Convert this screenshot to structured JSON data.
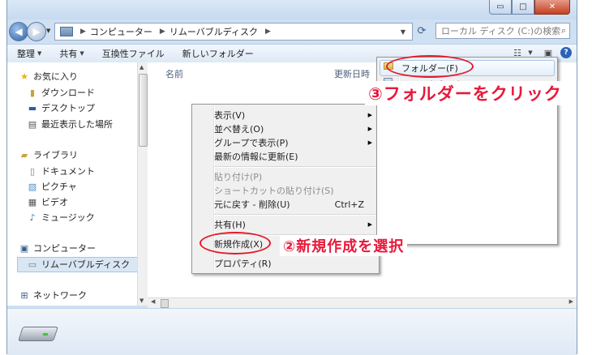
{
  "window": {
    "caption_buttons": {
      "minimize": "▭",
      "maximize": "□",
      "close": "✕"
    }
  },
  "address_bar": {
    "crumbs": [
      "コンピューター",
      "リムーバブルディスク"
    ]
  },
  "search": {
    "placeholder": "ローカル ディスク (C:)の検索"
  },
  "toolbar": {
    "organize": "整理",
    "share": "共有",
    "compat_files": "互換性ファイル",
    "new_folder": "新しいフォルダー"
  },
  "nav": {
    "favorites": "お気に入り",
    "downloads": "ダウンロード",
    "desktop": "デスクトップ",
    "recent": "最近表示した場所",
    "libraries": "ライブラリ",
    "documents": "ドキュメント",
    "pictures": "ピクチャ",
    "videos": "ビデオ",
    "music": "ミュージック",
    "computer": "コンピューター",
    "removable": "リムーバブルディスク",
    "network": "ネットワーク"
  },
  "columns": {
    "name": "名前",
    "date": "更新日時"
  },
  "context_menu": {
    "view": "表示(V)",
    "sort": "並べ替え(O)",
    "group": "グループで表示(P)",
    "refresh": "最新の情報に更新(E)",
    "paste": "貼り付け(P)",
    "paste_shortcut": "ショートカットの貼り付け(S)",
    "undo": "元に戻す - 削除(U)",
    "undo_shortcut": "Ctrl+Z",
    "share": "共有(H)",
    "new": "新規作成(X)",
    "properties": "プロパティ(R)"
  },
  "submenu": {
    "folder": "フォルダー(F)",
    "shortcut": "ショートカット(S)"
  },
  "annotations": {
    "step3": "③フォルダーをクリック",
    "step2": "②新規作成を選択"
  },
  "colors": {
    "accent_red": "#e8183a",
    "highlight": "#d9e6f4"
  }
}
